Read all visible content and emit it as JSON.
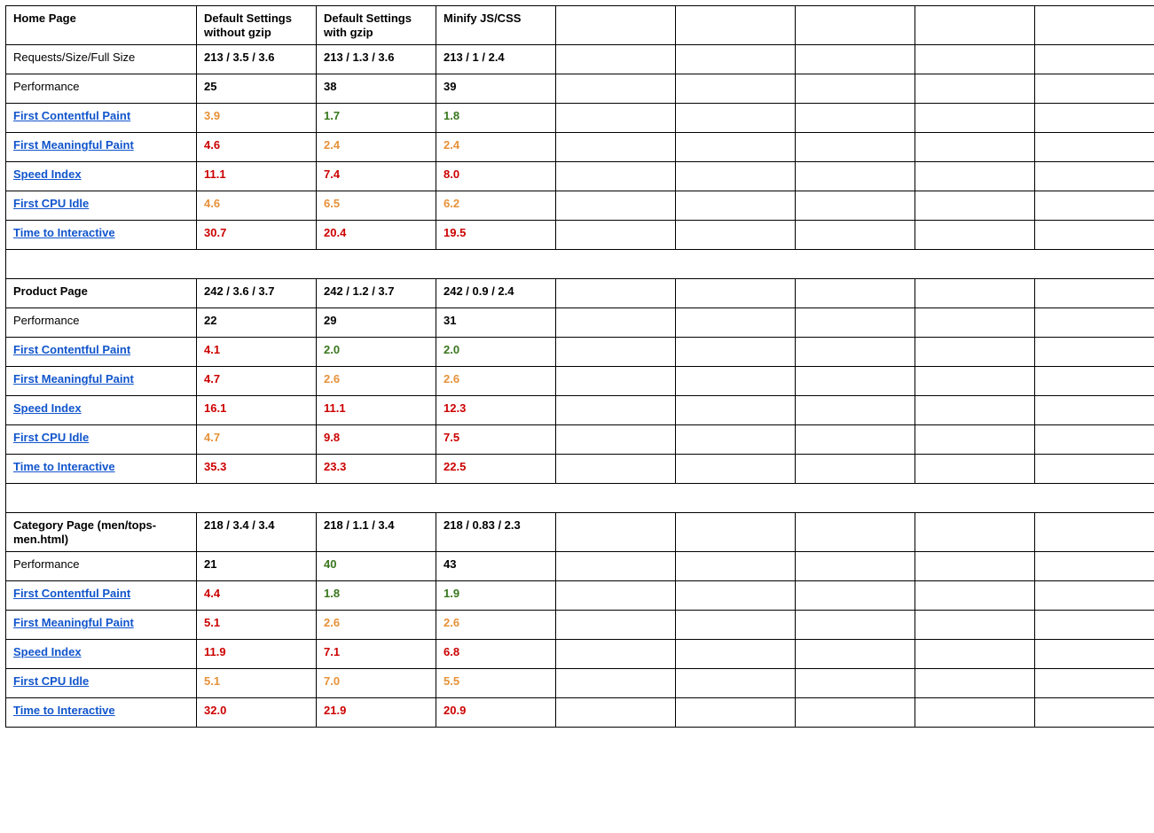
{
  "columns": {
    "col1": "Default Settings without  gzip",
    "col2": "Default Settings with gzip",
    "col3": "Minify JS/CSS"
  },
  "metricLabels": {
    "requests": "Requests/Size/Full Size",
    "performance": "Performance",
    "fcp": "First Contentful Paint",
    "fmp": "First Meaningful Paint",
    "si": "Speed Index",
    "fci": "First CPU Idle",
    "tti": "Time to Interactive"
  },
  "sections": {
    "home": {
      "title": "Home Page",
      "rows": {
        "requests": {
          "c1": "213 / 3.5 / 3.6",
          "c2": "213 / 1.3 / 3.6",
          "c3": "213 / 1 / 2.4"
        },
        "performance": {
          "c1": "25",
          "c2": "38",
          "c3": "39"
        },
        "fcp": {
          "c1": "3.9",
          "c2": "1.7",
          "c3": "1.8"
        },
        "fmp": {
          "c1": "4.6",
          "c2": "2.4",
          "c3": "2.4"
        },
        "si": {
          "c1": "11.1",
          "c2": "7.4",
          "c3": "8.0"
        },
        "fci": {
          "c1": "4.6",
          "c2": "6.5",
          "c3": "6.2"
        },
        "tti": {
          "c1": "30.7",
          "c2": "20.4",
          "c3": "19.5"
        }
      },
      "colors": {
        "fcp": {
          "c1": "orange",
          "c2": "green",
          "c3": "green"
        },
        "fmp": {
          "c1": "red",
          "c2": "orange",
          "c3": "orange"
        },
        "si": {
          "c1": "red",
          "c2": "red",
          "c3": "red"
        },
        "fci": {
          "c1": "orange",
          "c2": "orange",
          "c3": "orange"
        },
        "tti": {
          "c1": "red",
          "c2": "red",
          "c3": "red"
        }
      }
    },
    "product": {
      "title": "Product Page",
      "rows": {
        "requests": {
          "c1": "242 / 3.6 / 3.7",
          "c2": "242 / 1.2 / 3.7",
          "c3": "242 / 0.9 / 2.4"
        },
        "performance": {
          "c1": "22",
          "c2": "29",
          "c3": "31"
        },
        "fcp": {
          "c1": "4.1",
          "c2": "2.0",
          "c3": "2.0"
        },
        "fmp": {
          "c1": "4.7",
          "c2": "2.6",
          "c3": "2.6"
        },
        "si": {
          "c1": "16.1",
          "c2": "11.1",
          "c3": "12.3"
        },
        "fci": {
          "c1": "4.7",
          "c2": "9.8",
          "c3": "7.5"
        },
        "tti": {
          "c1": "35.3",
          "c2": "23.3",
          "c3": "22.5"
        }
      },
      "colors": {
        "fcp": {
          "c1": "red",
          "c2": "green",
          "c3": "green"
        },
        "fmp": {
          "c1": "red",
          "c2": "orange",
          "c3": "orange"
        },
        "si": {
          "c1": "red",
          "c2": "red",
          "c3": "red"
        },
        "fci": {
          "c1": "orange",
          "c2": "red",
          "c3": "red"
        },
        "tti": {
          "c1": "red",
          "c2": "red",
          "c3": "red"
        }
      }
    },
    "category": {
      "title": "Category Page (men/tops-men.html)",
      "rows": {
        "requests": {
          "c1": "218 / 3.4 / 3.4",
          "c2": "218 / 1.1 / 3.4",
          "c3": "218 / 0.83 / 2.3"
        },
        "performance": {
          "c1": "21",
          "c2": "40",
          "c3": "43"
        },
        "fcp": {
          "c1": "4.4",
          "c2": "1.8",
          "c3": "1.9"
        },
        "fmp": {
          "c1": "5.1",
          "c2": "2.6",
          "c3": "2.6"
        },
        "si": {
          "c1": "11.9",
          "c2": "7.1",
          "c3": "6.8"
        },
        "fci": {
          "c1": "5.1",
          "c2": "7.0",
          "c3": "5.5"
        },
        "tti": {
          "c1": "32.0",
          "c2": "21.9",
          "c3": "20.9"
        }
      },
      "colors": {
        "performance": {
          "c1": "bold",
          "c2": "green",
          "c3": "bold"
        },
        "fcp": {
          "c1": "red",
          "c2": "green",
          "c3": "green"
        },
        "fmp": {
          "c1": "red",
          "c2": "orange",
          "c3": "orange"
        },
        "si": {
          "c1": "red",
          "c2": "red",
          "c3": "red"
        },
        "fci": {
          "c1": "orange",
          "c2": "orange",
          "c3": "orange"
        },
        "tti": {
          "c1": "red",
          "c2": "red",
          "c3": "red"
        }
      }
    }
  }
}
